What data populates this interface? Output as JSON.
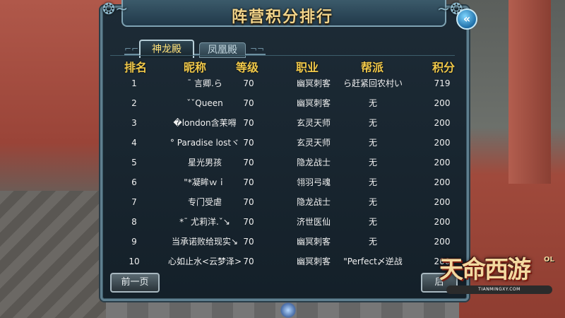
{
  "title": "阵营积分排行",
  "tabs": [
    {
      "label": "神龙殿",
      "active": true
    },
    {
      "label": "凤凰殿",
      "active": false
    }
  ],
  "columns": [
    "排名",
    "昵称",
    "等级",
    "职业",
    "帮派",
    "积分"
  ],
  "rows": [
    {
      "rank": "1",
      "name": "¯ 言卿.ら",
      "level": "70",
      "class": "幽冥刺客",
      "guild": "ら赶紧回农村い",
      "score": "719"
    },
    {
      "rank": "2",
      "name": "ˇˇQueen",
      "level": "70",
      "class": "幽冥刺客",
      "guild": "无",
      "score": "200"
    },
    {
      "rank": "3",
      "name": "�london含苿嘚",
      "level": "70",
      "class": "玄灵天师",
      "guild": "无",
      "score": "200"
    },
    {
      "rank": "4",
      "name": "° Paradise  lostヾ",
      "level": "70",
      "class": "玄灵天师",
      "guild": "无",
      "score": "200"
    },
    {
      "rank": "5",
      "name": "星光男孩",
      "level": "70",
      "class": "隐龙战士",
      "guild": "无",
      "score": "200"
    },
    {
      "rank": "6",
      "name": "\"*凝眸ｗｉ",
      "level": "70",
      "class": "翎羽弓魂",
      "guild": "无",
      "score": "200"
    },
    {
      "rank": "7",
      "name": "专门受虐",
      "level": "70",
      "class": "隐龙战士",
      "guild": "无",
      "score": "200"
    },
    {
      "rank": "8",
      "name": "*¯  尤莉洋.ˇ↘",
      "level": "70",
      "class": "济世医仙",
      "guild": "无",
      "score": "200"
    },
    {
      "rank": "9",
      "name": "当承诺败给现实↘",
      "level": "70",
      "class": "幽冥刺客",
      "guild": "无",
      "score": "200"
    },
    {
      "rank": "10",
      "name": "心如止水<云梦泽>",
      "level": "70",
      "class": "幽冥刺客",
      "guild": "\"Perfect〆逆战",
      "score": "200"
    }
  ],
  "buttons": {
    "prev": "前一页",
    "next": "后"
  },
  "close_icon": "close-arrow-icon",
  "logo": {
    "text": "天命西游",
    "suffix": "OL",
    "url": "TIANMINGXY.COM"
  }
}
